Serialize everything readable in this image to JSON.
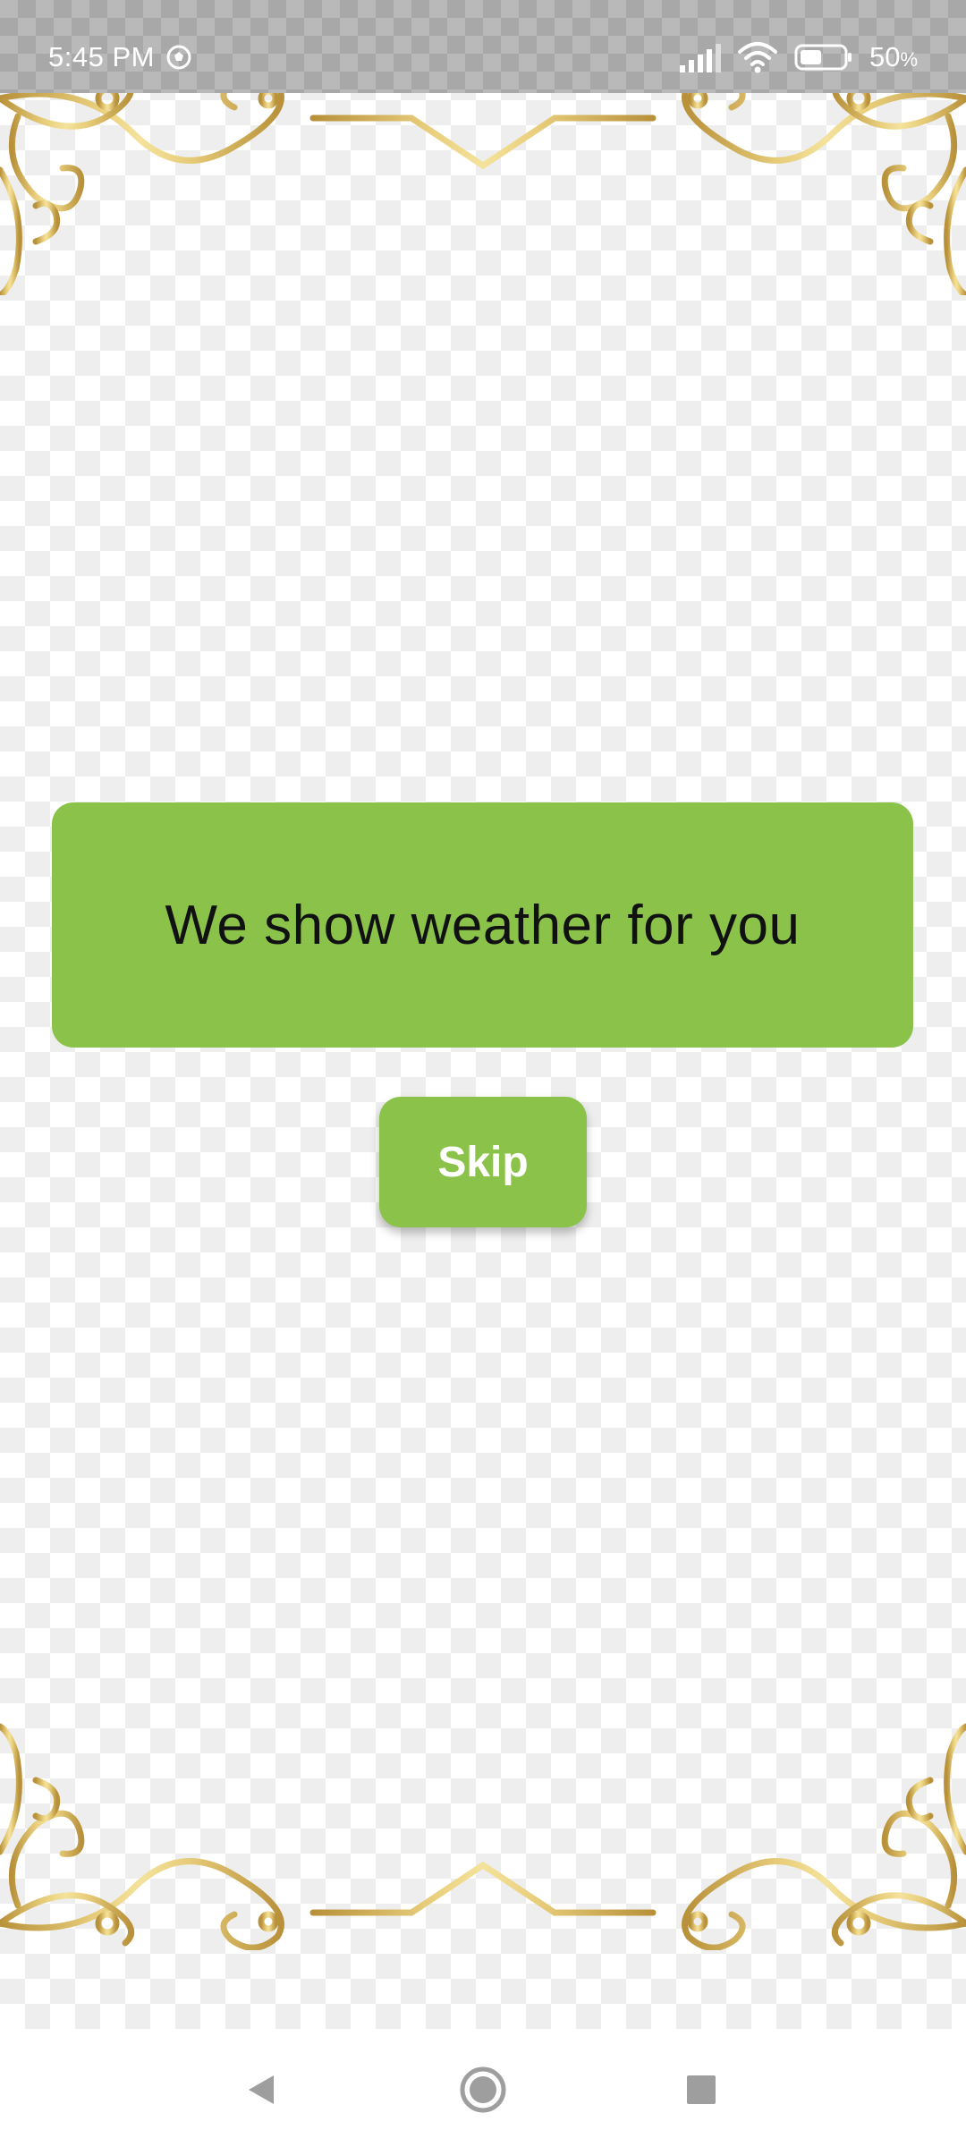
{
  "status_bar": {
    "time": "5:45 PM",
    "battery_percent": "50",
    "battery_unit": "%",
    "battery_level": 0.5,
    "icons": [
      "soccer-ball-icon",
      "signal-icon",
      "wifi-icon",
      "battery-icon"
    ]
  },
  "main": {
    "message": "We show weather for you",
    "skip_label": "Skip"
  },
  "colors": {
    "accent_green": "#8bc34a",
    "ornament_gold": "#c9a64a",
    "message_text": "#111111"
  },
  "nav_bar": {
    "icons": [
      "back-icon",
      "home-icon",
      "recents-icon"
    ]
  }
}
